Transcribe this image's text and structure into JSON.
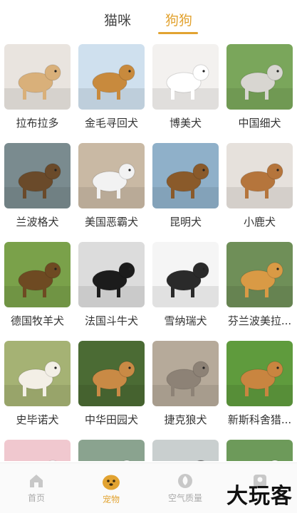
{
  "tabs": [
    {
      "label": "猫咪",
      "active": false
    },
    {
      "label": "狗狗",
      "active": true
    }
  ],
  "accent_color": "#e2a331",
  "breeds": [
    {
      "name": "拉布拉多",
      "bg": "#e9e4df",
      "dog": "#d9b07a"
    },
    {
      "name": "金毛寻回犬",
      "bg": "#cfe0ee",
      "dog": "#c88a3d"
    },
    {
      "name": "博美犬",
      "bg": "#f3f1ef",
      "dog": "#ffffff"
    },
    {
      "name": "中国细犬",
      "bg": "#7aa65b",
      "dog": "#d8d6d1"
    },
    {
      "name": "兰波格犬",
      "bg": "#7a8b8f",
      "dog": "#6a4a2a"
    },
    {
      "name": "美国恶霸犬",
      "bg": "#c9b9a4",
      "dog": "#f2f2f2"
    },
    {
      "name": "昆明犬",
      "bg": "#8fb0c9",
      "dog": "#8a5a2a"
    },
    {
      "name": "小鹿犬",
      "bg": "#e6e1dc",
      "dog": "#b5753c"
    },
    {
      "name": "德国牧羊犬",
      "bg": "#7aa14a",
      "dog": "#6e4a22"
    },
    {
      "name": "法国斗牛犬",
      "bg": "#dcdcdc",
      "dog": "#1c1c1c"
    },
    {
      "name": "雪纳瑞犬",
      "bg": "#f5f5f5",
      "dog": "#2a2a2a"
    },
    {
      "name": "芬兰波美拉...",
      "bg": "#6f8f58",
      "dog": "#d99a45"
    },
    {
      "name": "史毕诺犬",
      "bg": "#a5b274",
      "dog": "#f3efe6"
    },
    {
      "name": "中华田园犬",
      "bg": "#4b6b34",
      "dog": "#c98a45"
    },
    {
      "name": "捷克狼犬",
      "bg": "#b6aa9a",
      "dog": "#8d8276"
    },
    {
      "name": "新斯科舍猎...",
      "bg": "#5f9b3d",
      "dog": "#c98540"
    },
    {
      "name": "",
      "bg": "#f0c8cf",
      "dog": "#ffffff"
    },
    {
      "name": "",
      "bg": "#8aa38f",
      "dog": "#ffffff"
    },
    {
      "name": "",
      "bg": "#c9cfcf",
      "dog": "#6e6e6e"
    },
    {
      "name": "",
      "bg": "#6d9a5a",
      "dog": "#ffffff"
    }
  ],
  "nav": [
    {
      "label": "首页",
      "icon": "home-icon",
      "active": false
    },
    {
      "label": "宠物",
      "icon": "pet-icon",
      "active": true
    },
    {
      "label": "空气质量",
      "icon": "leaf-icon",
      "active": false
    },
    {
      "label": "",
      "icon": "profile-icon",
      "active": false
    }
  ],
  "watermark": "大玩客"
}
